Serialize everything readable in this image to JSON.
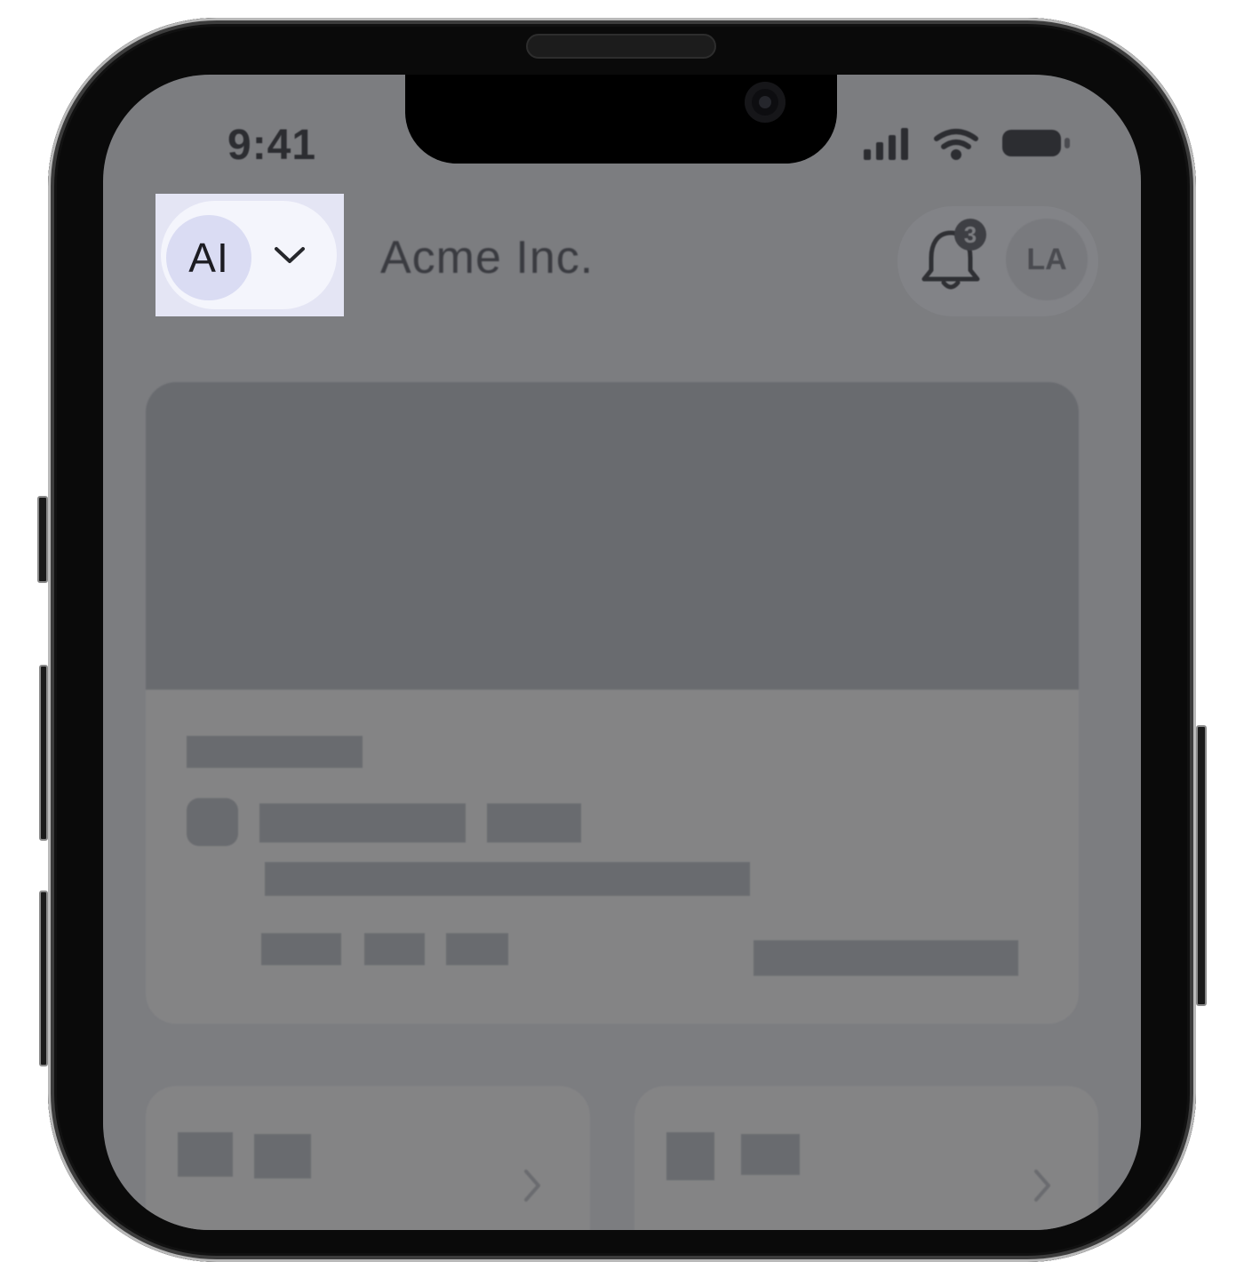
{
  "status_bar": {
    "time": "9:41",
    "icons": [
      "cellular-signal-icon",
      "wifi-icon",
      "battery-icon"
    ]
  },
  "header": {
    "ai_toggle": {
      "label": "AI",
      "icon": "chevron-down-icon",
      "highlighted": true
    },
    "company_name": "Acme Inc.",
    "notifications": {
      "icon": "bell-icon",
      "badge_count": "3"
    },
    "user_avatar_initials": "LA"
  },
  "colors": {
    "overlay": "#7c7d80",
    "highlight_bg": "#e4e5f4",
    "pill_bg": "#f4f5fc",
    "avatar_bg": "#dadcf3",
    "skeleton": "#696b6f"
  },
  "mini_cards": [
    {
      "icon": "chevron-right-icon"
    },
    {
      "icon": "chevron-right-icon"
    }
  ]
}
